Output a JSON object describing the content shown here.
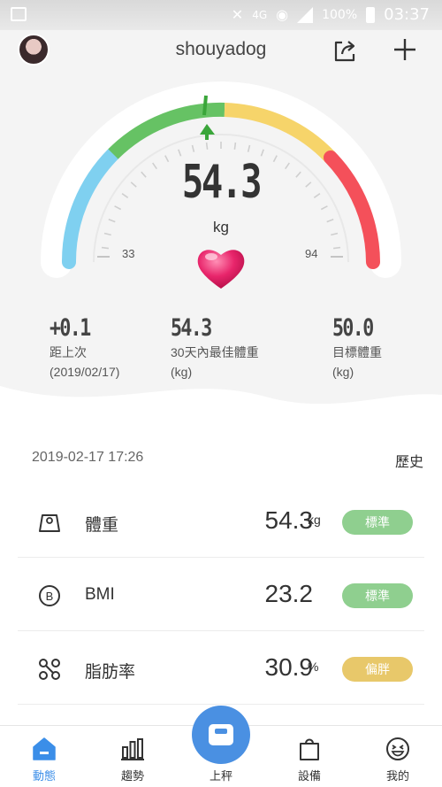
{
  "status_bar": {
    "network": "4G",
    "battery": "100%",
    "time": "03:37"
  },
  "header": {
    "username": "shouyadog"
  },
  "gauge": {
    "value": "54.3",
    "unit": "kg",
    "min_label": "33",
    "max_label": "94",
    "min": 33,
    "max": 94,
    "current": 54.3
  },
  "stats": [
    {
      "value": "+0.1",
      "label_line1": "距上次",
      "label_line2": "(2019/02/17)"
    },
    {
      "value": "54.3",
      "label_line1": "30天內最佳體重",
      "label_line2": "(kg)"
    },
    {
      "value": "50.0",
      "label_line1": "目標體重",
      "label_line2": "(kg)"
    }
  ],
  "record": {
    "datetime": "2019-02-17 17:26",
    "history_label": "歷史"
  },
  "metrics": [
    {
      "name": "體重",
      "value": "54.3",
      "unit": "kg",
      "badge": "標準",
      "badge_color": "#8fcf8f",
      "icon": "weight-icon"
    },
    {
      "name": "BMI",
      "value": "23.2",
      "unit": "",
      "badge": "標準",
      "badge_color": "#8fcf8f",
      "icon": "bmi-icon"
    },
    {
      "name": "脂肪率",
      "value": "30.9",
      "unit": "%",
      "badge": "偏胖",
      "badge_color": "#e8c86a",
      "icon": "fat-icon"
    }
  ],
  "nav": {
    "home": "動態",
    "trend": "趨勢",
    "scale": "上秤",
    "device": "設備",
    "me": "我的"
  },
  "colors": {
    "accent": "#4a90e2",
    "arc_blue": "#7fd0f0",
    "arc_green": "#66c264",
    "arc_yellow": "#f6d46a",
    "arc_red": "#f4505a"
  }
}
